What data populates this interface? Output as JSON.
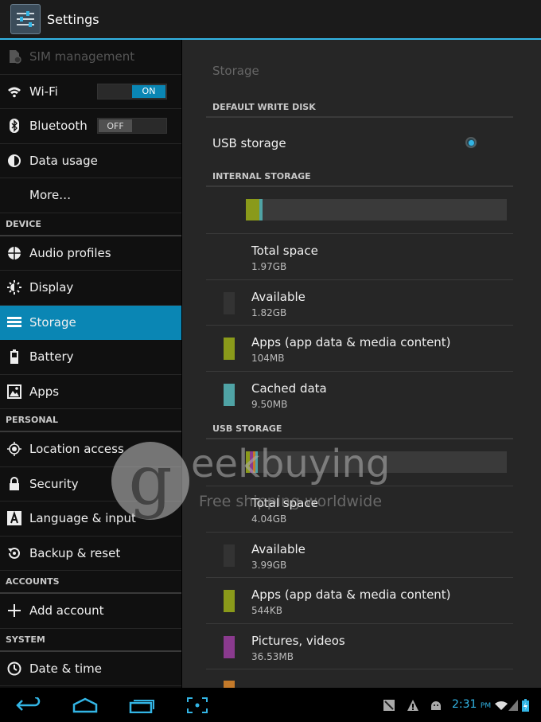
{
  "app": {
    "title": "Settings"
  },
  "nav": {
    "top_items": [
      {
        "label": "SIM management",
        "icon": "sim-icon",
        "disabled": true
      },
      {
        "label": "Wi-Fi",
        "icon": "wifi-icon",
        "toggle": "ON"
      },
      {
        "label": "Bluetooth",
        "icon": "bluetooth-icon",
        "toggle": "OFF"
      },
      {
        "label": "Data usage",
        "icon": "data-usage-icon"
      },
      {
        "label": "More…",
        "icon": ""
      }
    ],
    "device_header": "DEVICE",
    "device_items": [
      {
        "label": "Audio profiles",
        "icon": "audio-profiles-icon"
      },
      {
        "label": "Display",
        "icon": "display-icon"
      },
      {
        "label": "Storage",
        "icon": "storage-icon",
        "active": true
      },
      {
        "label": "Battery",
        "icon": "battery-icon"
      },
      {
        "label": "Apps",
        "icon": "apps-icon"
      }
    ],
    "personal_header": "PERSONAL",
    "personal_items": [
      {
        "label": "Location access",
        "icon": "location-icon"
      },
      {
        "label": "Security",
        "icon": "lock-icon"
      },
      {
        "label": "Language & input",
        "icon": "language-icon"
      },
      {
        "label": "Backup & reset",
        "icon": "backup-icon"
      }
    ],
    "accounts_header": "ACCOUNTS",
    "accounts_items": [
      {
        "label": "Add account",
        "icon": "plus-icon"
      }
    ],
    "system_header": "SYSTEM",
    "system_items": [
      {
        "label": "Date & time",
        "icon": "clock-icon"
      }
    ]
  },
  "storage": {
    "page_title": "Storage",
    "default_write_disk_header": "DEFAULT WRITE DISK",
    "usb_storage_option": "USB storage",
    "internal_header": "INTERNAL STORAGE",
    "internal": {
      "usage_fractions": {
        "apps": 0.052,
        "cached": 0.005,
        "other": 0.0
      },
      "rows": [
        {
          "title": "Total space",
          "value": "1.97GB",
          "swatch": null
        },
        {
          "title": "Available",
          "value": "1.82GB",
          "swatch": "#333333"
        },
        {
          "title": "Apps (app data & media content)",
          "value": "104MB",
          "swatch": "#8a9a1a"
        },
        {
          "title": "Cached data",
          "value": "9.50MB",
          "swatch": "#4fa3a5"
        }
      ]
    },
    "usb_header": "USB STORAGE",
    "usb": {
      "rows": [
        {
          "title": "Total space",
          "value": "4.04GB",
          "swatch": null
        },
        {
          "title": "Available",
          "value": "3.99GB",
          "swatch": "#333333"
        },
        {
          "title": "Apps (app data & media content)",
          "value": "544KB",
          "swatch": "#8a9a1a"
        },
        {
          "title": "Pictures, videos",
          "value": "36.53MB",
          "swatch": "#8a3a8e"
        }
      ]
    }
  },
  "watermark": {
    "brand_letter": "g",
    "brand_word": "eekbuying",
    "tagline": "Free shipping worldwide"
  },
  "status": {
    "time": "2:31",
    "ampm": "PM"
  },
  "colors": {
    "accent": "#33b5e5",
    "selected": "#0a86b4"
  }
}
